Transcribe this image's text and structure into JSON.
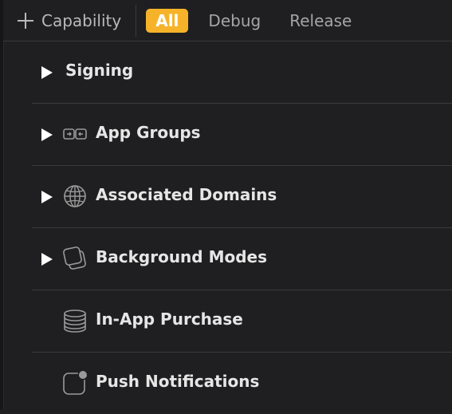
{
  "toolbar": {
    "add_label": "Capability",
    "filters": [
      "All",
      "Debug",
      "Release"
    ],
    "active_filter": "All"
  },
  "capabilities": [
    {
      "name": "Signing",
      "icon": "none",
      "expandable": true
    },
    {
      "name": "App Groups",
      "icon": "app-groups-icon",
      "expandable": true
    },
    {
      "name": "Associated Domains",
      "icon": "globe-icon",
      "expandable": true
    },
    {
      "name": "Background Modes",
      "icon": "layers-icon",
      "expandable": true
    },
    {
      "name": "In-App Purchase",
      "icon": "coins-icon",
      "expandable": false
    },
    {
      "name": "Push Notifications",
      "icon": "notification-icon",
      "expandable": false
    }
  ],
  "colors": {
    "accent": "#f6b32a",
    "background": "#1f1f21",
    "separator": "#3a3a3c"
  }
}
